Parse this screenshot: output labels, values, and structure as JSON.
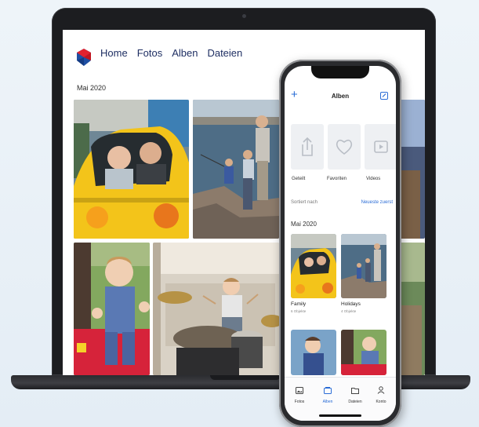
{
  "laptop": {
    "nav": [
      "Home",
      "Fotos",
      "Alben",
      "Dateien"
    ],
    "section_date": "Mai 2020"
  },
  "phone": {
    "header_title": "Alben",
    "categories": [
      "Geteilt",
      "Favoriten",
      "Videos"
    ],
    "sort_label": "Sortiert nach",
    "sort_value": "Neueste zuerst",
    "section_date": "Mai 2020",
    "albums": [
      {
        "name": "Family",
        "count": "6 Objekte"
      },
      {
        "name": "Holidays",
        "count": "4 Objekte"
      }
    ],
    "tabs": [
      "Fotos",
      "Alben",
      "Dateien",
      "Konto"
    ],
    "active_tab": "Alben"
  },
  "colors": {
    "nav_text": "#1f2f63",
    "accent": "#2a6cd6",
    "logo_red": "#e3222e",
    "logo_blue": "#1f4fa3"
  }
}
